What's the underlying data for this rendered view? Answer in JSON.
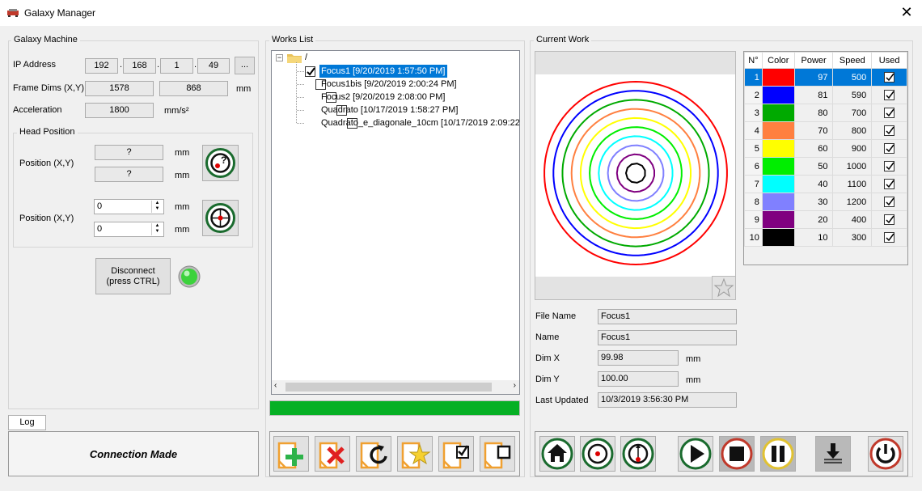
{
  "window": {
    "title": "Galaxy Manager"
  },
  "machine": {
    "group_label": "Galaxy Machine",
    "ip_label": "IP Address",
    "ip": [
      "192",
      "168",
      "1",
      "49"
    ],
    "ip_browse": "...",
    "frame_label": "Frame Dims (X,Y)",
    "frame_x": "1578",
    "frame_y": "868",
    "frame_unit": "mm",
    "accel_label": "Acceleration",
    "accel": "1800",
    "accel_unit": "mm/s²",
    "head_label": "Head Position",
    "pos_label_1": "Position (X,Y)",
    "pos_x": "?",
    "pos_y": "?",
    "pos_label_2": "Position (X,Y)",
    "set_x": "0",
    "set_y": "0",
    "unit": "mm",
    "disconnect_line1": "Disconnect",
    "disconnect_line2": "(press CTRL)"
  },
  "log": {
    "tab": "Log",
    "message": "Connection Made"
  },
  "works": {
    "group_label": "Works List",
    "root": "/",
    "items": [
      {
        "label": "Focus1 [9/20/2019 1:57:50 PM]",
        "checked": true,
        "selected": true
      },
      {
        "label": "Focus1bis [9/20/2019 2:00:24 PM]",
        "checked": false,
        "selected": false
      },
      {
        "label": "Focus2 [9/20/2019 2:08:00 PM]",
        "checked": false,
        "selected": false
      },
      {
        "label": "Quadrato [10/17/2019 1:58:27 PM]",
        "checked": false,
        "selected": false
      },
      {
        "label": "Quadrato_e_diagonale_10cm [10/17/2019 2:09:22",
        "checked": false,
        "selected": false
      }
    ],
    "progress_percent": 100
  },
  "current": {
    "group_label": "Current Work",
    "file_name_label": "File Name",
    "file_name": "Focus1",
    "name_label": "Name",
    "name": "Focus1",
    "dimx_label": "Dim X",
    "dimx": "99.98",
    "dimy_label": "Dim Y",
    "dimy": "100.00",
    "unit": "mm",
    "updated_label": "Last Updated",
    "updated": "10/3/2019 3:56:30 PM"
  },
  "layers": {
    "headers": [
      "N°",
      "Color",
      "Power",
      "Speed",
      "Used"
    ],
    "rows": [
      {
        "n": "1",
        "color": "#ff0000",
        "power": "97",
        "speed": "500",
        "used": true
      },
      {
        "n": "2",
        "color": "#0000ff",
        "power": "81",
        "speed": "590",
        "used": true
      },
      {
        "n": "3",
        "color": "#00aa00",
        "power": "80",
        "speed": "700",
        "used": true
      },
      {
        "n": "4",
        "color": "#ff8040",
        "power": "70",
        "speed": "800",
        "used": true
      },
      {
        "n": "5",
        "color": "#ffff00",
        "power": "60",
        "speed": "900",
        "used": true
      },
      {
        "n": "6",
        "color": "#00ee00",
        "power": "50",
        "speed": "1000",
        "used": true
      },
      {
        "n": "7",
        "color": "#00ffff",
        "power": "40",
        "speed": "1100",
        "used": true
      },
      {
        "n": "8",
        "color": "#8080ff",
        "power": "30",
        "speed": "1200",
        "used": true
      },
      {
        "n": "9",
        "color": "#800080",
        "power": "20",
        "speed": "400",
        "used": true
      },
      {
        "n": "10",
        "color": "#000000",
        "power": "10",
        "speed": "300",
        "used": true
      }
    ]
  },
  "colors": {
    "accent": "#0078d7",
    "progress": "#06b025",
    "led": "#3cd23c"
  }
}
